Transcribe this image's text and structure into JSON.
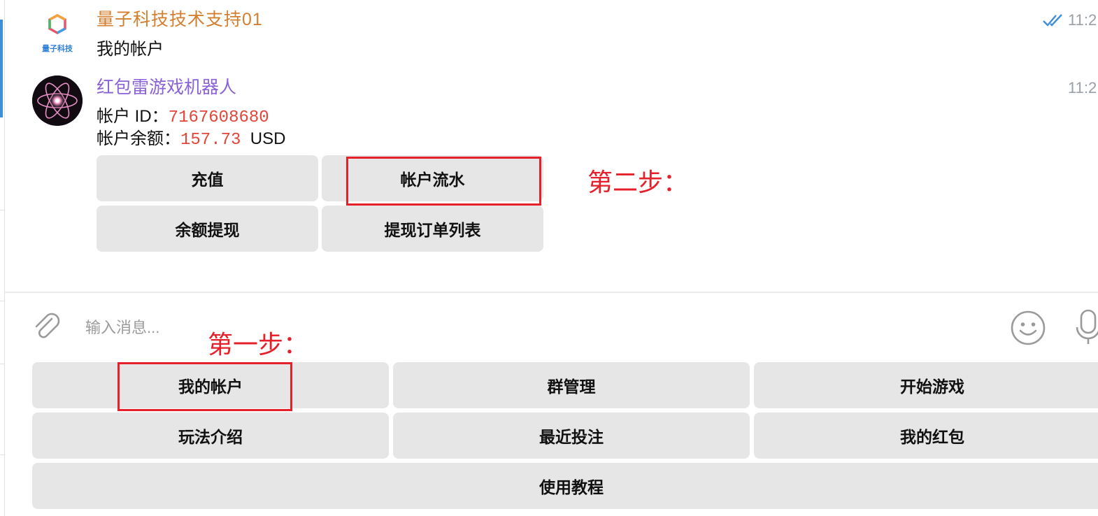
{
  "chat": {
    "messages": [
      {
        "sender": "量子科技技术支持01",
        "avatar_logo_text": "量子科技",
        "text": "我的帐户",
        "time": "11:2",
        "read_status": "double-check-icon"
      },
      {
        "sender": "红包雷游戏机器人",
        "time": "11:2",
        "account_id_label": "帐户 ID：",
        "account_id_value": "7167608680",
        "balance_label": "帐户余额：",
        "balance_value": "157.73",
        "balance_currency": "USD",
        "inline_buttons": [
          {
            "label": "充值"
          },
          {
            "label": "帐户流水"
          },
          {
            "label": "余额提现"
          },
          {
            "label": "提现订单列表"
          }
        ]
      }
    ]
  },
  "annotations": {
    "step1": "第一步：",
    "step2": "第二步：",
    "highlight_color": "#e5202a"
  },
  "composer": {
    "placeholder": "输入消息...",
    "attach_icon": "paperclip-icon",
    "emoji_icon": "smiley-icon",
    "mic_icon": "microphone-icon"
  },
  "keyboard": {
    "rows": [
      [
        "我的帐户",
        "群管理",
        "开始游戏"
      ],
      [
        "玩法介绍",
        "最近投注",
        "我的红包"
      ],
      [
        "使用教程"
      ]
    ]
  },
  "colors": {
    "sender1": "#d37f2f",
    "sender2": "#8a62d8",
    "value": "#e4453a",
    "button_bg": "#e6e6e6",
    "accent": "#3f8ed8"
  }
}
